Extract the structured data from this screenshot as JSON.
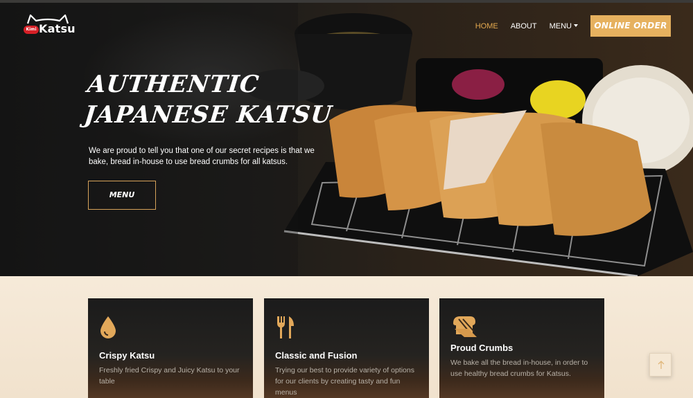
{
  "brand": {
    "badge": "Kimi",
    "name": "Katsu"
  },
  "nav": {
    "items": [
      {
        "label": "HOME",
        "active": true
      },
      {
        "label": "ABOUT",
        "active": false
      },
      {
        "label": "MENU",
        "active": false,
        "dropdown": true
      }
    ],
    "order_button": "ONLINE ORDER"
  },
  "hero": {
    "title_line1": "AUTHENTIC",
    "title_line2": "JAPANESE KATSU",
    "description": "We are proud to tell you that one of our secret recipes is that we bake, bread in-house to use bread crumbs for all katsus.",
    "menu_button": "MENU"
  },
  "features": [
    {
      "icon": "droplet-icon",
      "title": "Crispy Katsu",
      "text": "Freshly fried Crispy and Juicy Katsu to your table"
    },
    {
      "icon": "utensils-icon",
      "title": "Classic and Fusion",
      "text": "Trying our best to provide variety of options for our clients by creating tasty and fun menus"
    },
    {
      "icon": "bread-icon",
      "title": "Proud Crumbs",
      "text": "We bake all the bread in-house, in order to use healthy bread crumbs for Katsus."
    }
  ],
  "colors": {
    "accent": "#e6b15f",
    "active_nav": "#e4a94f",
    "brand_red": "#d61f26"
  },
  "scroll_top_icon": "arrow-up-icon"
}
